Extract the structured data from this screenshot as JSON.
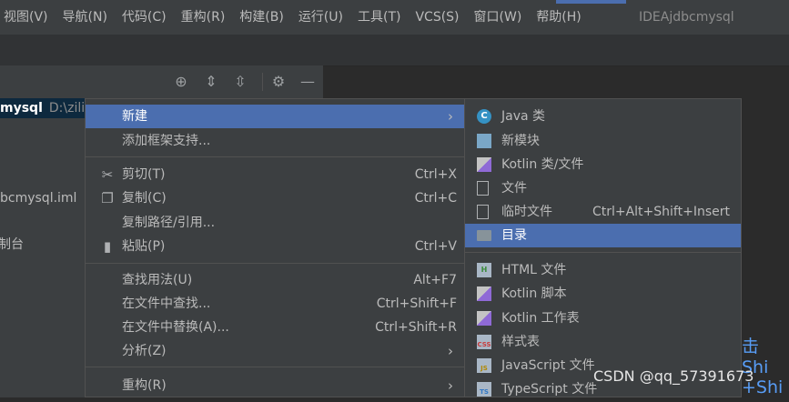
{
  "menubar": {
    "items": [
      "视图(V)",
      "导航(N)",
      "代码(C)",
      "重构(R)",
      "构建(B)",
      "运行(U)",
      "工具(T)",
      "VCS(S)",
      "窗口(W)",
      "帮助(H)"
    ],
    "window_title": "IDEAjdbcmysql"
  },
  "tree": {
    "root_name": "mysql",
    "root_path": "D:\\zili",
    "file1": "bcmysql.iml",
    "file2": "制台"
  },
  "editor": {
    "hint1": "击 Shi",
    "hint2": "+Shi"
  },
  "context_menu": {
    "items": [
      {
        "label": "新建",
        "shortcut": "",
        "submenu": true
      },
      {
        "label": "添加框架支持...",
        "shortcut": ""
      },
      {
        "label": "剪切(T)",
        "shortcut": "Ctrl+X",
        "icon": "scissors-icon"
      },
      {
        "label": "复制(C)",
        "shortcut": "Ctrl+C",
        "icon": "copy-icon"
      },
      {
        "label": "复制路径/引用...",
        "shortcut": ""
      },
      {
        "label": "粘贴(P)",
        "shortcut": "Ctrl+V",
        "icon": "clipboard-icon"
      },
      {
        "label": "查找用法(U)",
        "shortcut": "Alt+F7"
      },
      {
        "label": "在文件中查找...",
        "shortcut": "Ctrl+Shift+F"
      },
      {
        "label": "在文件中替换(A)...",
        "shortcut": "Ctrl+Shift+R"
      },
      {
        "label": "分析(Z)",
        "shortcut": "",
        "submenu": true
      },
      {
        "label": "重构(R)",
        "shortcut": "",
        "submenu": true
      }
    ]
  },
  "new_submenu": {
    "items": [
      {
        "label": "Java 类",
        "icon": "java-class-icon",
        "icon_text": "C"
      },
      {
        "label": "新模块",
        "icon": "module-icon"
      },
      {
        "label": "Kotlin 类/文件",
        "icon": "kotlin-icon"
      },
      {
        "label": "文件",
        "icon": "file-icon"
      },
      {
        "label": "临时文件",
        "shortcut": "Ctrl+Alt+Shift+Insert",
        "icon": "scratch-file-icon"
      },
      {
        "label": "目录",
        "icon": "folder-icon"
      },
      {
        "label": "HTML 文件",
        "icon": "html-icon",
        "icon_text": "H"
      },
      {
        "label": "Kotlin 脚本",
        "icon": "kotlin-script-icon"
      },
      {
        "label": "Kotlin 工作表",
        "icon": "kotlin-worksheet-icon"
      },
      {
        "label": "样式表",
        "icon": "css-icon",
        "icon_text": "CSS"
      },
      {
        "label": "JavaScript 文件",
        "icon": "js-icon",
        "icon_text": "JS"
      },
      {
        "label": "TypeScript 文件",
        "icon": "ts-icon",
        "icon_text": "TS"
      }
    ]
  },
  "watermark": "CSDN @qq_57391673",
  "colors": {
    "selection": "#4b6eaf",
    "menu_bg": "#3c3f41",
    "hint": "#589df6"
  }
}
